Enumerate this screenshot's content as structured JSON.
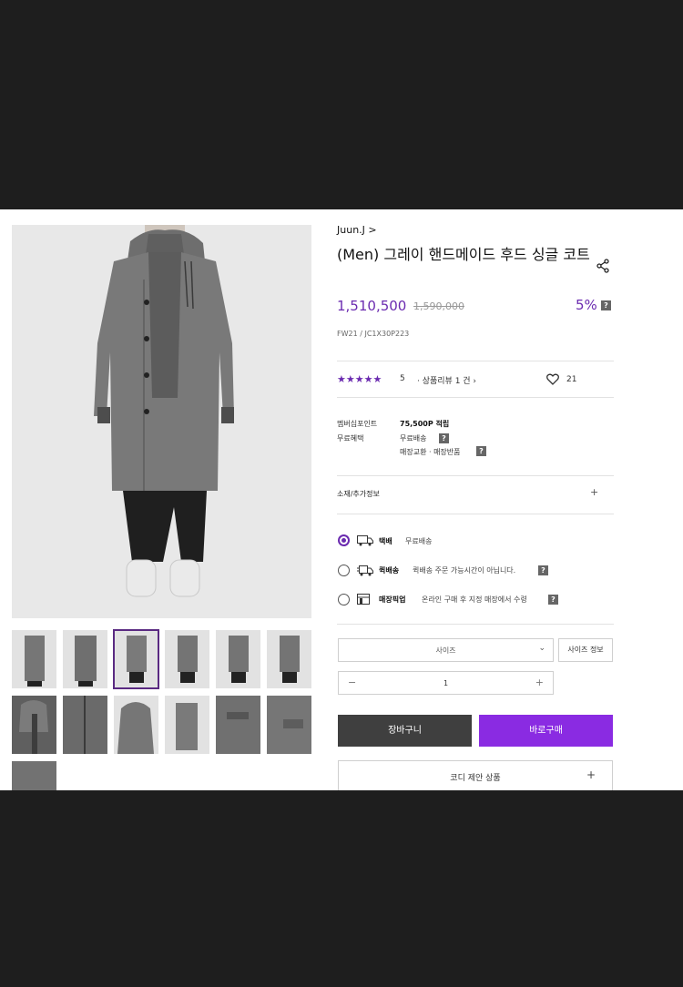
{
  "product": {
    "brand": "Juun.J >",
    "title": "(Men) 그레이 핸드메이드 후드 싱글 코트",
    "price": "1,510,500",
    "original_price": "1,590,000",
    "discount": "5%",
    "code": "FW21 / JC1X30P223",
    "stars": "★★★★★",
    "rating": "5",
    "review_text": "· 상품리뷰  1 건 ›",
    "likes": "21"
  },
  "benefits": {
    "points_label": "멤버십포인트",
    "points_value": "75,500P 적립",
    "benefit_label": "무료혜택",
    "benefit_1": "무료배송",
    "benefit_2": "매장교환 · 매장반품"
  },
  "info_section": "소재/추가정보",
  "shipping": [
    {
      "label": "택배",
      "desc": "무료배송",
      "selected": true
    },
    {
      "label": "퀵배송",
      "desc": "퀵배송 주문 가능시간이 아닙니다.",
      "selected": false
    },
    {
      "label": "매장픽업",
      "desc": "온라인 구매 후 지정 매장에서 수령",
      "selected": false
    }
  ],
  "options": {
    "size_placeholder": "사이즈",
    "size_info": "사이즈 정보",
    "quantity": "1"
  },
  "buttons": {
    "cart": "장바구니",
    "buy": "바로구매"
  },
  "coord_section": "코디 제안 상품",
  "icons": [
    "share-icon",
    "heart-icon",
    "help-icon",
    "plus-icon",
    "chevron-down-icon",
    "truck-icon",
    "quick-truck-icon",
    "store-icon"
  ],
  "colors": {
    "accent": "#6b2bb0",
    "buy": "#8a2be2",
    "cart": "#3f3f3f"
  }
}
